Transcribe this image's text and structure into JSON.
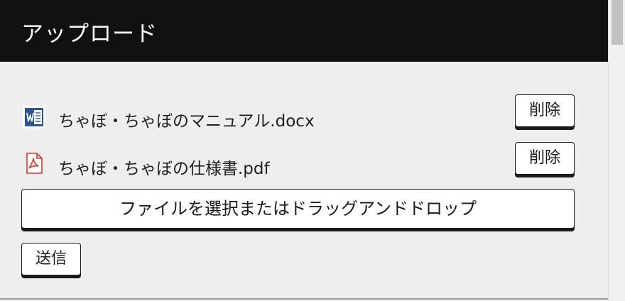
{
  "header": {
    "title": "アップロード"
  },
  "files": [
    {
      "name": "ちゃぼ・ちゃぼのマニュアル.docx",
      "icon": "word-document-icon",
      "delete_label": "削除"
    },
    {
      "name": "ちゃぼ・ちゃぼの仕様書.pdf",
      "icon": "pdf-document-icon",
      "delete_label": "削除"
    }
  ],
  "select_button": {
    "label": "ファイルを選択またはドラッグアンドドロップ"
  },
  "submit_button": {
    "label": "送信"
  },
  "colors": {
    "header_bg": "#111111",
    "page_bg": "#eeeeee",
    "word_blue": "#2b579a",
    "pdf_red": "#e5322d"
  }
}
